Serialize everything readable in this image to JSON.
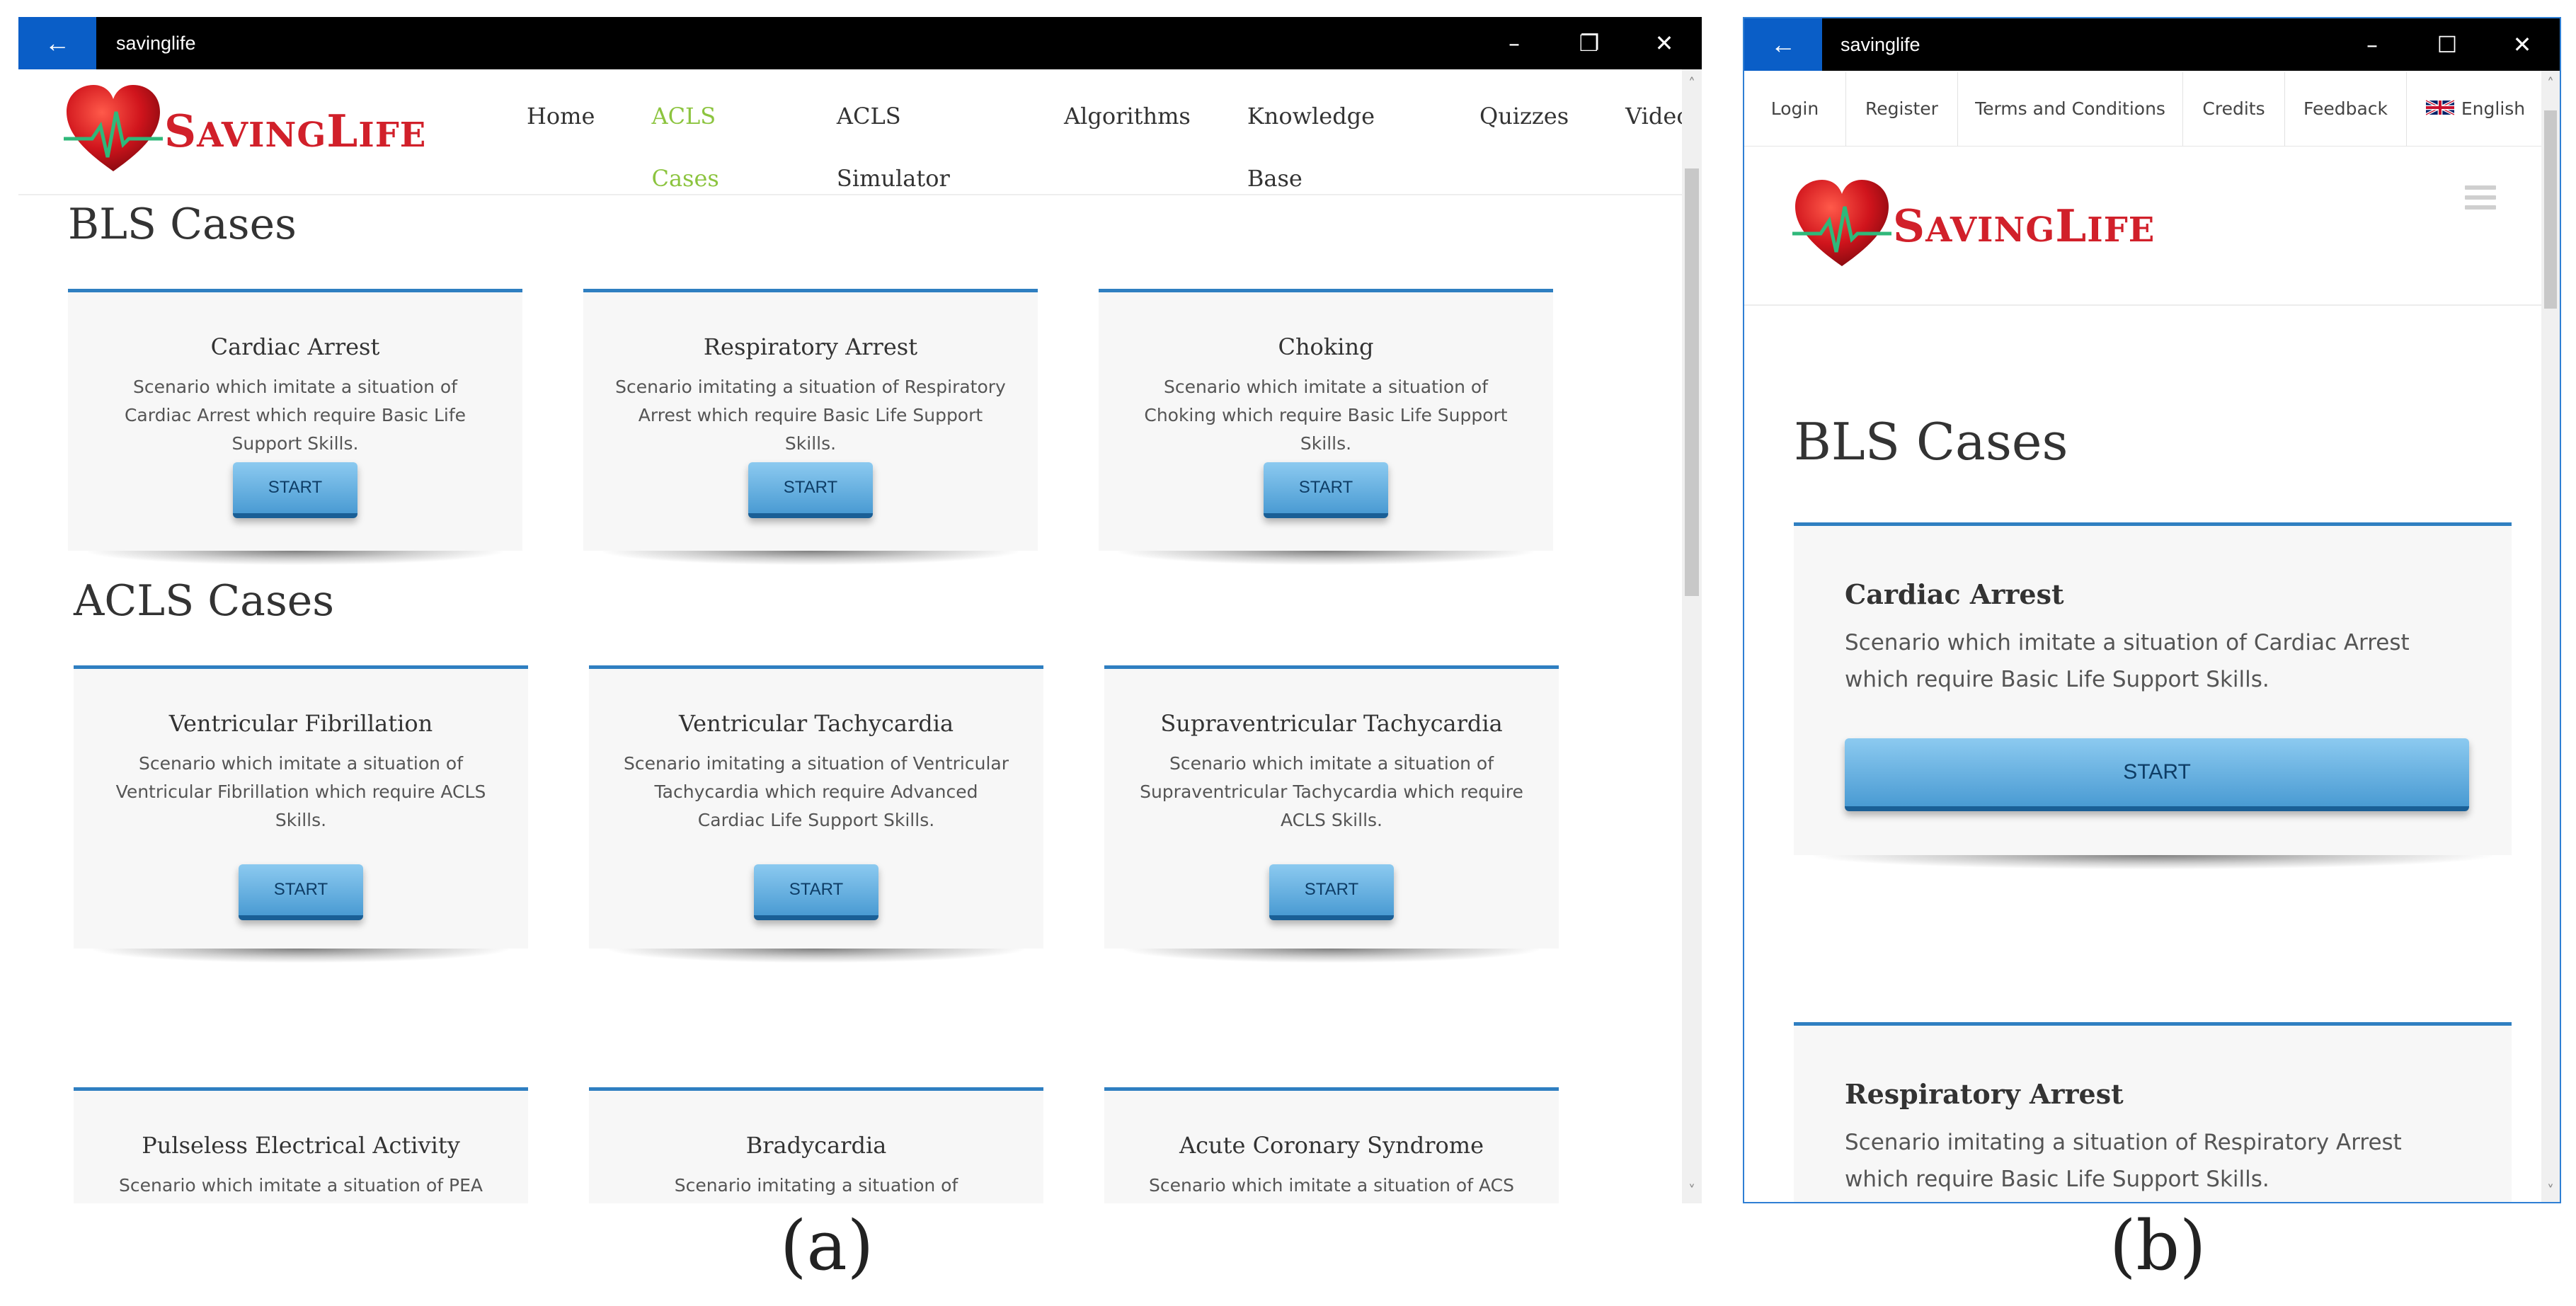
{
  "window_a": {
    "title": "savinglife",
    "logo": {
      "text_s": "S",
      "text_rest": "AVING",
      "text_l": "L",
      "text_rest2": "IFE"
    },
    "nav": [
      {
        "label": "Home",
        "active": false
      },
      {
        "label": "ACLS Cases",
        "active": true
      },
      {
        "label": "ACLS Simulator",
        "active": false
      },
      {
        "label": "Algorithms",
        "active": false
      },
      {
        "label": "Knowledge Base",
        "active": false
      },
      {
        "label": "Quizzes",
        "active": false
      },
      {
        "label": "Videos",
        "active": false
      }
    ],
    "bls_title": "BLS Cases",
    "acls_title": "ACLS Cases",
    "bls_cards": [
      {
        "title": "Cardiac Arrest",
        "desc": "Scenario which imitate a situation of Cardiac Arrest which require Basic Life Support Skills.",
        "button": "START"
      },
      {
        "title": "Respiratory Arrest",
        "desc": "Scenario imitating a situation of Respiratory Arrest which require Basic Life Support Skills.",
        "button": "START"
      },
      {
        "title": "Choking",
        "desc": "Scenario which imitate a situation of Choking which require Basic Life Support Skills.",
        "button": "START"
      }
    ],
    "acls_cards": [
      {
        "title": "Ventricular Fibrillation",
        "desc": "Scenario which imitate a situation of Ventricular Fibrillation which require ACLS Skills.",
        "button": "START"
      },
      {
        "title": "Ventricular Tachycardia",
        "desc": "Scenario imitating a situation of Ventricular Tachycardia which require Advanced Cardiac Life Support Skills.",
        "button": "START"
      },
      {
        "title": "Supraventricular Tachycardia",
        "desc": "Scenario which imitate a situation of Supraventricular Tachycardia which require ACLS Skills.",
        "button": "START"
      }
    ],
    "acls_cards_2": [
      {
        "title": "Pulseless Electrical Activity",
        "desc": "Scenario which imitate a situation of PEA"
      },
      {
        "title": "Bradycardia",
        "desc": "Scenario imitating a situation of Bradycardia"
      },
      {
        "title": "Acute Coronary Syndrome",
        "desc": "Scenario which imitate a situation of ACS"
      }
    ]
  },
  "window_b": {
    "title": "savinglife",
    "topnav": [
      "Login",
      "Register",
      "Terms and Conditions",
      "Credits",
      "Feedback"
    ],
    "language": "English",
    "bls_title": "BLS Cases",
    "cards": [
      {
        "title": "Cardiac Arrest",
        "desc": "Scenario which imitate a situation of Cardiac Arrest which require Basic Life Support Skills.",
        "button": "START"
      },
      {
        "title": "Respiratory Arrest",
        "desc": "Scenario imitating a situation of Respiratory Arrest which require Basic Life Support Skills."
      }
    ]
  },
  "captions": {
    "a": "(a)",
    "b": "(b)"
  },
  "icons": {
    "back": "back-arrow-icon",
    "minimize": "minimize-icon",
    "restore": "restore-icon",
    "maximize": "maximize-icon",
    "close": "close-icon",
    "menu": "hamburger-menu-icon",
    "flag": "uk-flag-icon",
    "logo": "heart-ecg-logo-icon"
  },
  "colors": {
    "accent_blue": "#2f7fc1",
    "active_nav": "#8cc43f",
    "logo_red": "#d1202a",
    "titlebar_back": "#0a5ec7"
  }
}
